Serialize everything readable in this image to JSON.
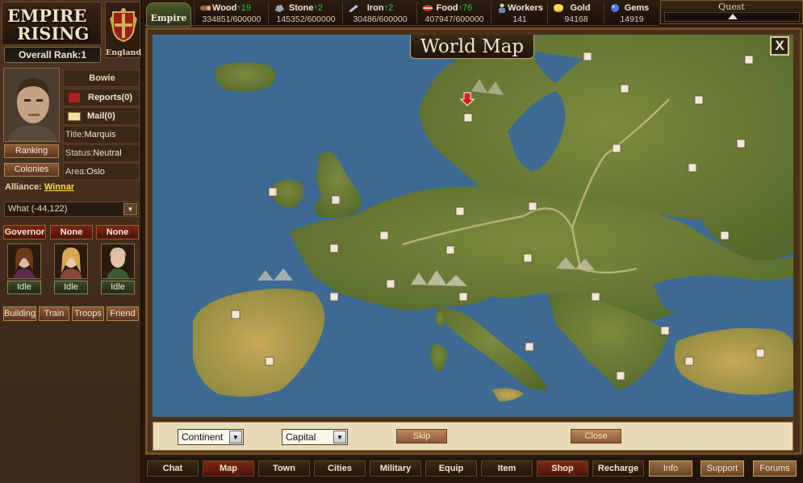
{
  "logo": {
    "line1": "EMPIRE",
    "line2": "RISING"
  },
  "crest": {
    "label": "England"
  },
  "rank": {
    "text": "Overall Rank:1"
  },
  "player": {
    "name": "Bowie",
    "reports": "Reports(0)",
    "mail": "Mail(0)",
    "title_label": "Title:",
    "title_value": "Marquis",
    "status_label": "Status:",
    "status_value": "Neutral",
    "area_label": "Area:",
    "area_value": "Oslo"
  },
  "side_buttons": {
    "ranking": "Ranking",
    "colonies": "Colonies"
  },
  "alliance": {
    "label": "Alliance:",
    "name": "Winnar"
  },
  "city_select": {
    "value": "What (-44,122)"
  },
  "governors": [
    {
      "head": "Governor",
      "status": "Idle"
    },
    {
      "head": "None",
      "status": "Idle"
    },
    {
      "head": "None",
      "status": "Idle"
    }
  ],
  "tabs": [
    "Building",
    "Train",
    "Troops",
    "Friend"
  ],
  "empire_tab": "Empire",
  "resources": [
    {
      "name": "Wood",
      "inc": "19",
      "value": "334851/600000",
      "icon": "wood-icon"
    },
    {
      "name": "Stone",
      "inc": "2",
      "value": "145352/600000",
      "icon": "stone-icon"
    },
    {
      "name": "Iron",
      "inc": "2",
      "value": "30486/600000",
      "icon": "iron-icon"
    },
    {
      "name": "Food",
      "inc": "76",
      "value": "407947/600000",
      "icon": "food-icon"
    },
    {
      "name": "Workers",
      "inc": "",
      "value": "141",
      "icon": "workers-icon"
    },
    {
      "name": "Gold",
      "inc": "",
      "value": "94168",
      "icon": "gold-icon"
    },
    {
      "name": "Gems",
      "inc": "",
      "value": "14919",
      "icon": "gems-icon"
    }
  ],
  "quest": {
    "label": "Quest"
  },
  "map": {
    "title": "World Map",
    "close": "X"
  },
  "controls": {
    "region_select": "Continent",
    "mode_select": "Capital",
    "skip": "Skip",
    "close": "Close"
  },
  "nav": [
    "Chat",
    "Map",
    "Town",
    "Cities",
    "Military",
    "Equip",
    "Item",
    "Shop",
    "Recharge",
    "Info",
    "Support",
    "Forums"
  ],
  "colors": {
    "accent": "#8a5a36",
    "resource_inc": "#2bd32b",
    "alliance_link": "#ffe23a",
    "sea": "#3c6a93",
    "land": "#6b7a34"
  }
}
